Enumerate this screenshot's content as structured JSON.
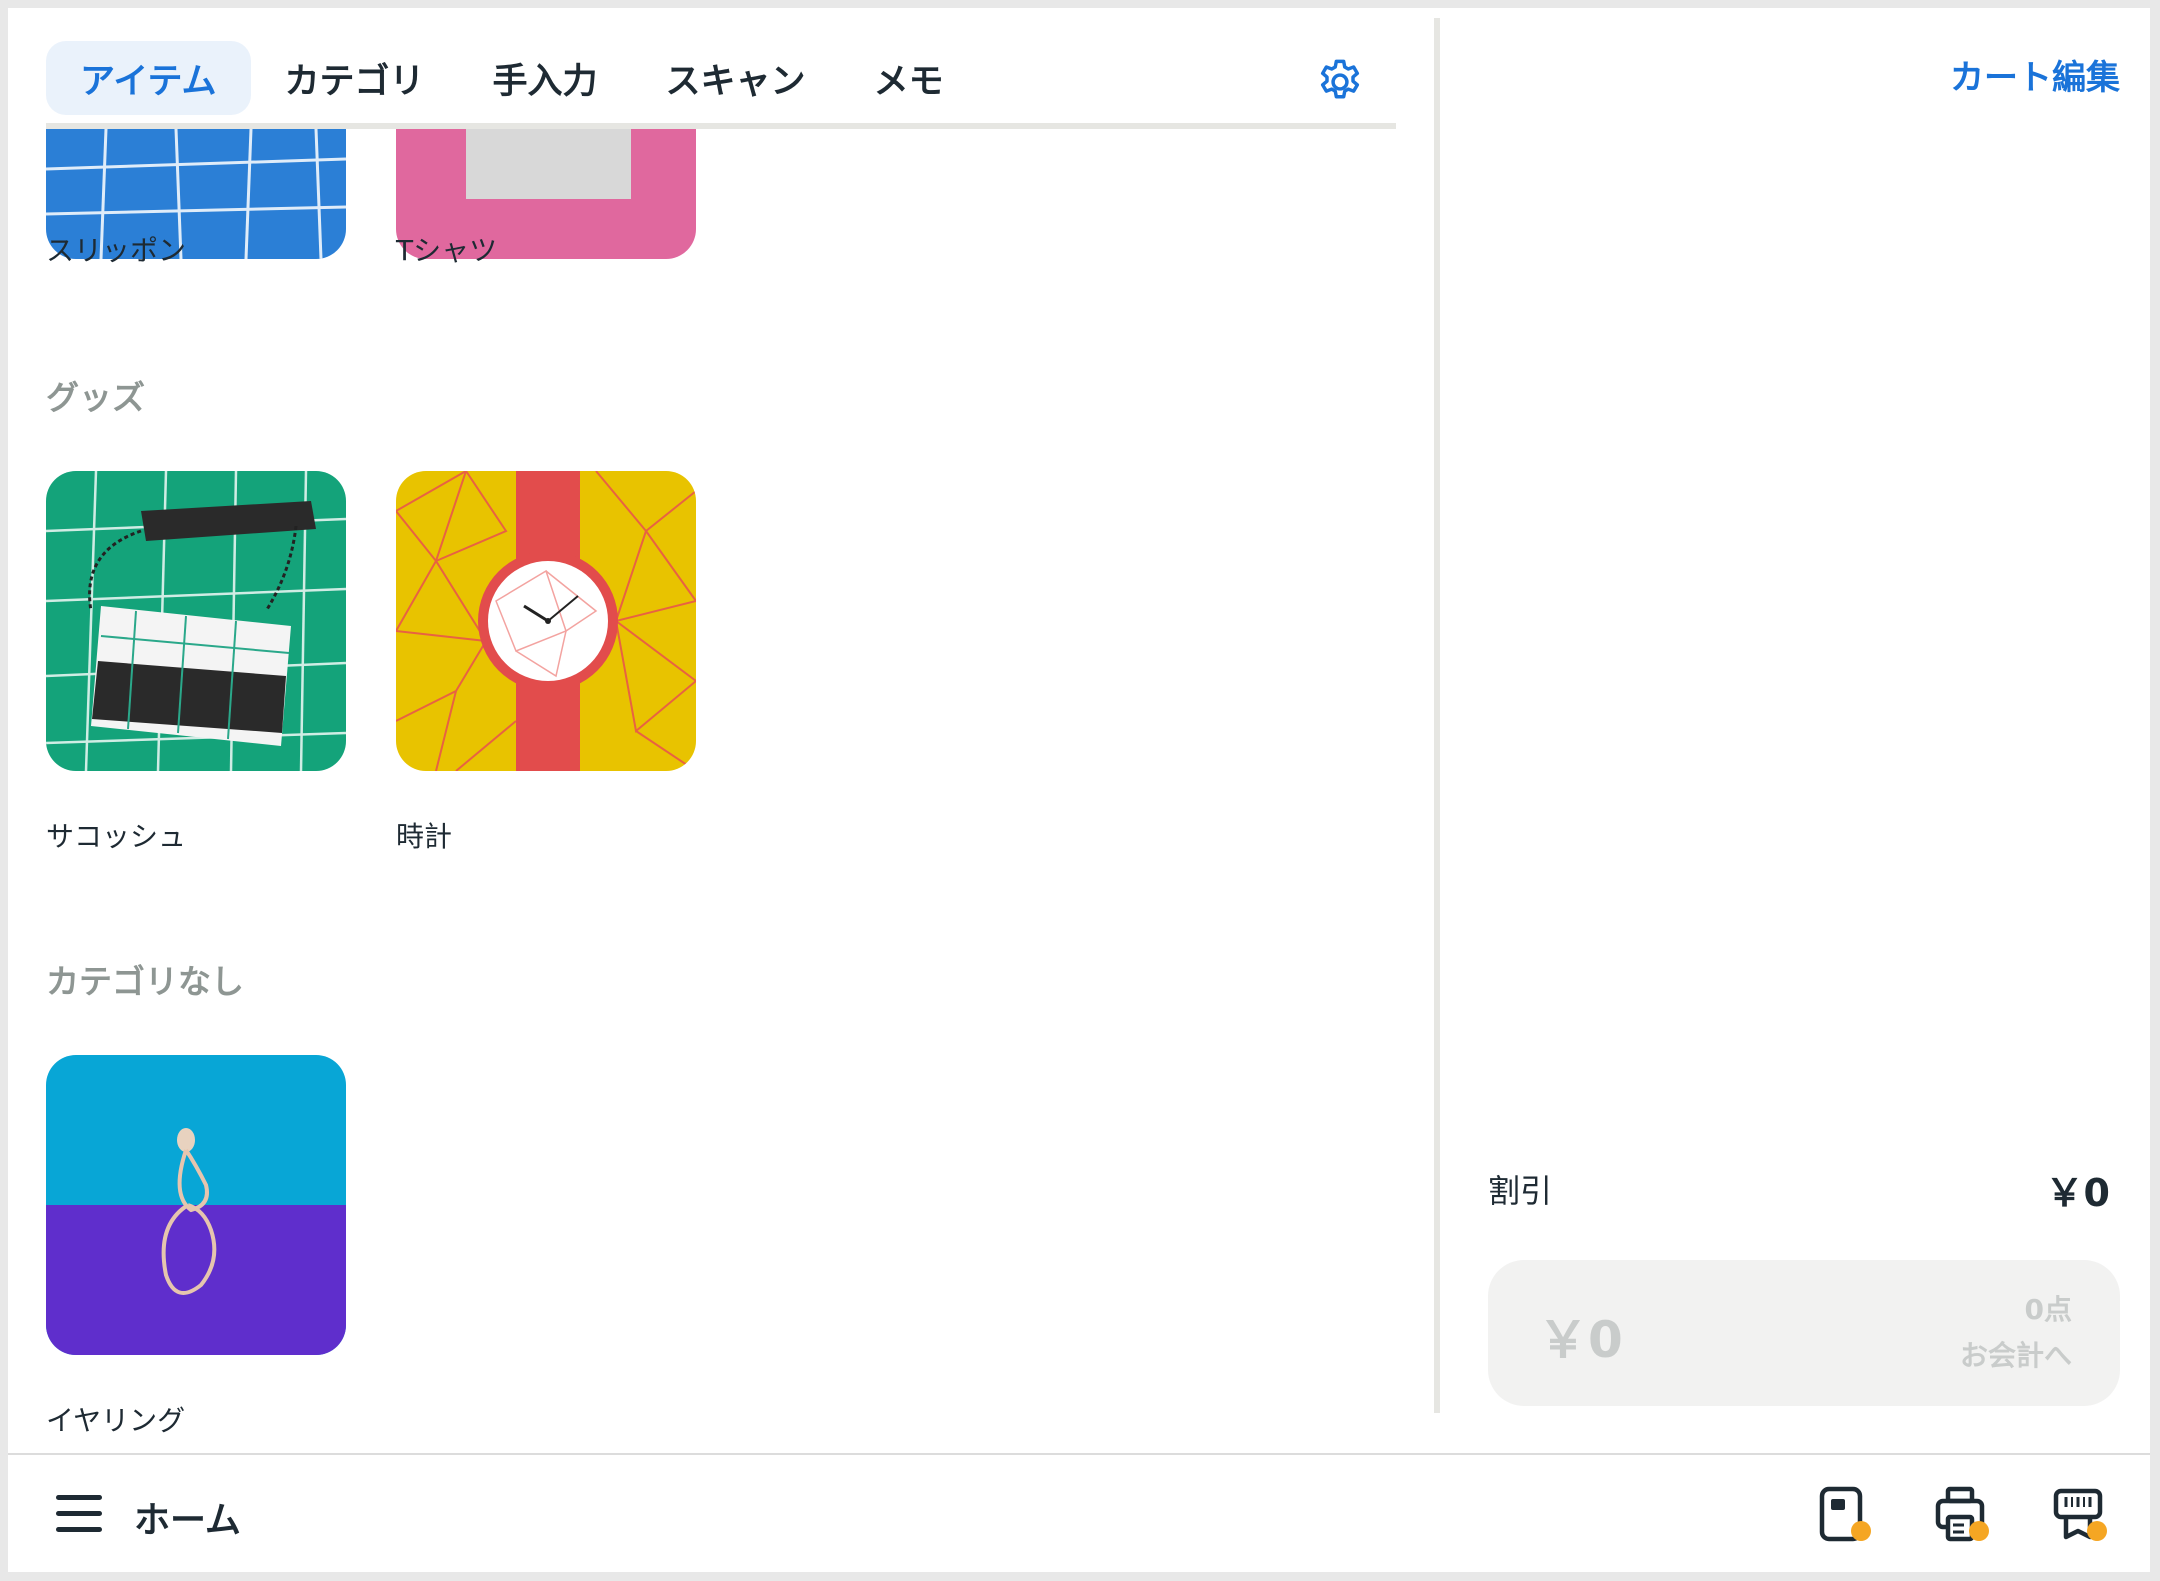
{
  "tabs": [
    {
      "label": "アイテム",
      "active": true
    },
    {
      "label": "カテゴリ",
      "active": false
    },
    {
      "label": "手入力",
      "active": false
    },
    {
      "label": "スキャン",
      "active": false
    },
    {
      "label": "メモ",
      "active": false
    }
  ],
  "settings_icon": "gear-icon",
  "partial_items": [
    {
      "label": "スリッポン",
      "tile_color": "#2b7fd6"
    },
    {
      "label": "Tシャツ",
      "tile_color": "#e0689e"
    }
  ],
  "sections": [
    {
      "title": "グッズ",
      "items": [
        {
          "label": "サコッシュ",
          "tile_color": "#14a37a"
        },
        {
          "label": "時計",
          "tile_color": "#e8c300"
        }
      ]
    },
    {
      "title": "カテゴリなし",
      "items": [
        {
          "label": "イヤリング",
          "tile_color_top": "#08a6d6",
          "tile_color_bottom": "#5f2ecc"
        }
      ]
    }
  ],
  "cart": {
    "edit_label": "カート編集",
    "discount_label": "割引",
    "discount_value": "￥0",
    "checkout": {
      "total": "￥0",
      "count": "0点",
      "label": "お会計へ"
    }
  },
  "bottom_bar": {
    "menu_icon": "hamburger-menu-icon",
    "home_label": "ホーム",
    "device_icons": [
      "card-reader-icon",
      "receipt-printer-icon",
      "barcode-printer-icon"
    ],
    "status_color": "#f5a623"
  },
  "accent_color": "#1a73d9"
}
